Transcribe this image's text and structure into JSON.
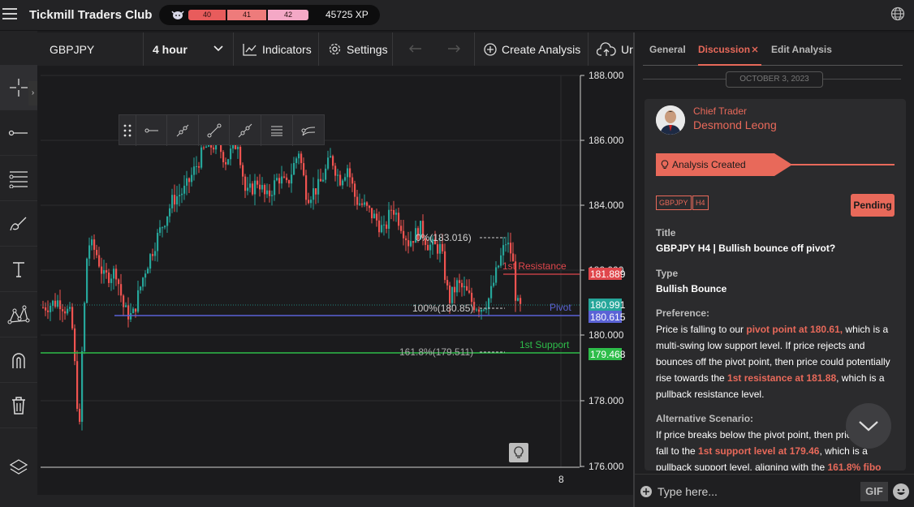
{
  "app": {
    "brand": "Tickmill Traders Club",
    "xp": {
      "segments": [
        "40",
        "41",
        "42"
      ],
      "total": "45725 XP"
    }
  },
  "toolbar": {
    "symbol": "GBPJPY",
    "timeframe": "4 hour",
    "indicators": "Indicators",
    "settings": "Settings",
    "create_analysis": "Create Analysis",
    "upload_partial": "Ur"
  },
  "left_tools": [
    "crosshair-icon",
    "horizontal-line-icon",
    "fib-lines-icon",
    "brush-icon",
    "text-icon",
    "pattern-icon",
    "magnet-icon",
    "trash-icon",
    "layers-icon"
  ],
  "floating_tools": [
    "horizontal-ray-icon",
    "ray-icon",
    "trend-line-icon",
    "extended-line-icon",
    "parallel-lines-icon",
    "curve-icon"
  ],
  "chart": {
    "price_ticks": [
      "188.000",
      "186.000",
      "184.000",
      "182.000",
      "180.000",
      "178.000",
      "176.000"
    ],
    "time_tick": "8",
    "levels": {
      "resistance": {
        "label": "1st Resistance",
        "price": "181.889",
        "color": "#e0474c"
      },
      "current": {
        "price": "180.991",
        "color": "#26a69a"
      },
      "pivot": {
        "label": "Pivot",
        "price": "180.615",
        "color": "#5b63d6"
      },
      "support": {
        "label": "1st Support",
        "price": "179.468",
        "color": "#2ebd4a"
      }
    },
    "fib": {
      "top": "0%(183.016)",
      "bottom": "100%(180.85)",
      "ext": "161.8%(179.511)"
    }
  },
  "right_panel": {
    "tabs": [
      "General",
      "Discussion",
      "Edit Analysis"
    ],
    "active_tab": "Discussion",
    "date": "OCTOBER 3, 2023",
    "post": {
      "role": "Chief Trader",
      "author": "Desmond Leong",
      "banner": "Analysis Created",
      "tags": [
        "GBPJPY",
        "H4"
      ],
      "status": "Pending",
      "title_label": "Title",
      "title": "GBPJPY H4 | Bullish bounce off pivot?",
      "type_label": "Type",
      "type": "Bullish Bounce",
      "preference_label": "Preference:",
      "preference": {
        "t1": "Price is falling to our ",
        "h1": "pivot point at 180.61,",
        "t2": " which is a multi-swing low support level. If price rejects and bounces off the pivot point, then price could potentially rise towards the ",
        "h2": "1st resistance at 181.88",
        "t3": ", which is a pullback resistance level."
      },
      "alt_label": "Alternative Scenario:",
      "alternative": {
        "t1": "If price breaks below the pivot point, then price could fall to the ",
        "h1": "1st support level at 179.46",
        "t2": ", which is a pullback support level, aligning with the ",
        "h2": "161.8% fibo"
      }
    },
    "composer_placeholder": "Type here...",
    "gif": "GIF"
  }
}
